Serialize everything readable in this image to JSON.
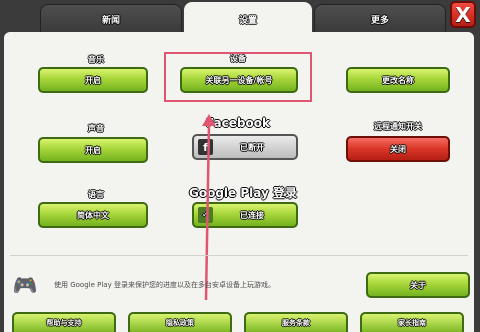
{
  "tabs": [
    {
      "label": "新闻",
      "active": false
    },
    {
      "label": "设置",
      "active": true
    },
    {
      "label": "更多",
      "active": false
    }
  ],
  "close_label": "X",
  "settings": {
    "music": {
      "label": "音乐",
      "button": "开启"
    },
    "sound": {
      "label": "声音",
      "button": "开启"
    },
    "language": {
      "label": "语言",
      "button": "简体中文"
    },
    "device": {
      "label": "设备",
      "button": "关联另一设备/帐号"
    },
    "facebook": {
      "label": "Facebook",
      "button": "已断开"
    },
    "google_play": {
      "label": "Google Play 登录",
      "button": "已连接"
    },
    "change_name": {
      "button": "更改名称"
    },
    "notifications": {
      "label": "远程通知开关",
      "button": "关闭"
    }
  },
  "google_play_info": {
    "text": "使用 Google Play 登录来保护您的进度以及在多台安卓设备上玩游戏。",
    "button": "关于"
  },
  "bottom_buttons": [
    "帮助与支持",
    "隐私政策",
    "服务条款",
    "家长指南"
  ],
  "colors": {
    "green_button": "#a7d63a",
    "red_button": "#d93528",
    "panel_bg": "#f3f3ef",
    "highlight": "#e05670"
  }
}
